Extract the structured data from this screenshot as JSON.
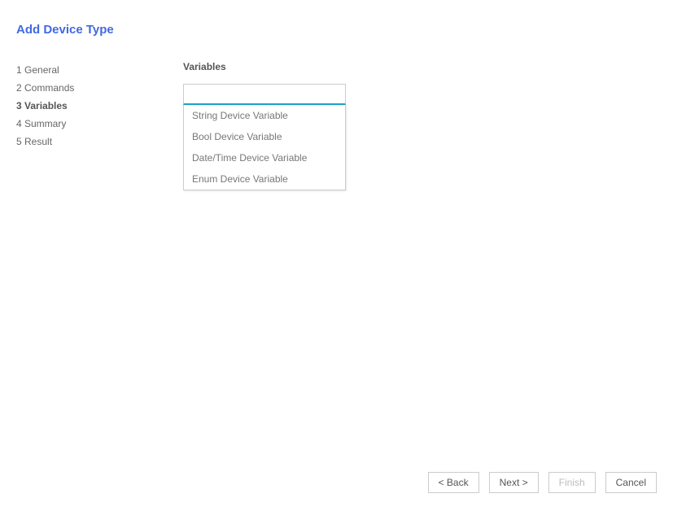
{
  "page_title": "Add Device Type",
  "sidebar": {
    "items": [
      {
        "label": "1 General",
        "active": false
      },
      {
        "label": "2 Commands",
        "active": false
      },
      {
        "label": "3 Variables",
        "active": true
      },
      {
        "label": "4 Summary",
        "active": false
      },
      {
        "label": "5 Result",
        "active": false
      }
    ]
  },
  "main": {
    "section_label": "Variables",
    "dropdown": {
      "value": "",
      "options": [
        "String Device Variable",
        "Bool Device Variable",
        "Date/Time Device Variable",
        "Enum Device Variable"
      ]
    }
  },
  "buttons": {
    "back": "< Back",
    "next": "Next >",
    "finish": "Finish",
    "cancel": "Cancel"
  }
}
